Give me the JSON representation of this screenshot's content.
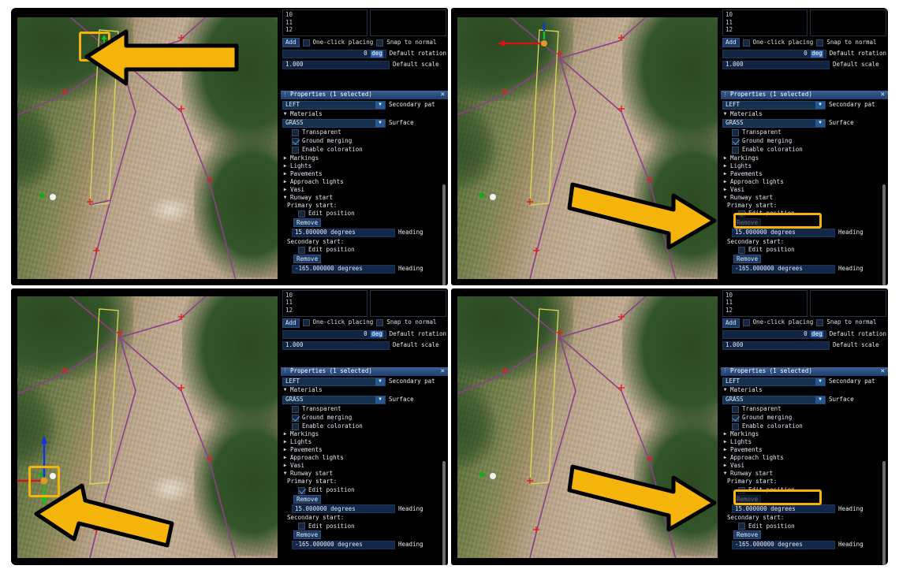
{
  "app": {
    "panel_title": "Properties (1 selected)",
    "close_glyph": "✕",
    "grip_glyph": "⋮"
  },
  "toolbar": {
    "list_items": [
      "10",
      "11",
      "12"
    ],
    "add_label": "Add",
    "one_click_label": "One-click placing",
    "snap_label": "Snap to normal",
    "rotation_value": "0",
    "rotation_unit": "deg",
    "rotation_caption": "Default rotation",
    "scale_value": "1.000",
    "scale_caption": "Default scale"
  },
  "properties": {
    "pattern_value": "LEFT",
    "pattern_caption": "Secondary pat",
    "materials_label": "Materials",
    "surface_value": "GRASS",
    "surface_caption": "Surface",
    "transparent_label": "Transparent",
    "ground_merging_label": "Ground merging",
    "enable_coloration_label": "Enable coloration",
    "sections": [
      "Markings",
      "Lights",
      "Pavements",
      "Approach lights",
      "Vasi"
    ],
    "runway_start_label": "Runway start",
    "primary_start_label": "Primary start:",
    "secondary_start_label": "Secondary start:",
    "edit_position_label": "Edit position",
    "remove_label": "Remove",
    "primary_heading_value": "15.000000 degrees",
    "secondary_heading_value": "-165.000000 degrees",
    "heading_caption": "Heading",
    "expand_collapsed": "▶",
    "expand_open": "▼"
  },
  "panels": [
    {
      "id": "top-left",
      "name": "step-1-before-click",
      "primary_edit_position_checked": false,
      "primary_edit_position_highlighted": false,
      "map_highlight": "runway-start-marker",
      "gizmo": "green-heading-arrow",
      "annotation_arrow": "points-left-to-map-marker"
    },
    {
      "id": "top-right",
      "name": "step-2-after-click",
      "primary_edit_position_checked": true,
      "primary_edit_position_highlighted": true,
      "map_highlight": "none",
      "gizmo": "axis-gizmo-red-green-blue",
      "annotation_arrow": "points-right-to-edit-position"
    },
    {
      "id": "bottom-left",
      "name": "step-3-gizmo-visible",
      "primary_edit_position_checked": true,
      "primary_edit_position_highlighted": false,
      "map_highlight": "axis-gizmo",
      "gizmo": "axis-gizmo-red-green-blue",
      "annotation_arrow": "points-left-to-gizmo"
    },
    {
      "id": "bottom-right",
      "name": "step-4-unchecked",
      "primary_edit_position_checked": false,
      "primary_edit_position_highlighted": true,
      "map_highlight": "none",
      "gizmo": "none",
      "annotation_arrow": "points-right-to-edit-position"
    }
  ],
  "colors": {
    "highlight": "#f5b40a",
    "panel_header": "#2b4c7d",
    "checkbox_check": "#4f9bec",
    "runway_outline": "#d8dc54",
    "taxiway_outline": "#8d3f8d",
    "node_marker": "#e02020",
    "background": "#000000"
  }
}
